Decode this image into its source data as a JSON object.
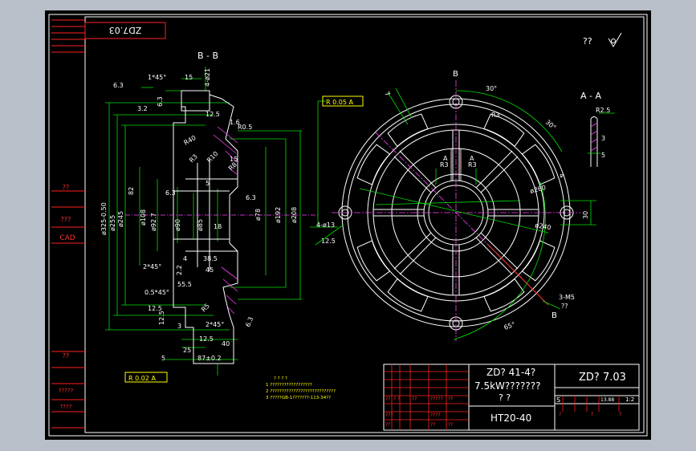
{
  "drawing": {
    "code_rotated": "ZD7.03",
    "sheet_marks": "??",
    "section_bb": "B - B",
    "section_aa": "A - A",
    "view_marker_b": "B",
    "view_marker_b_bottom": "B",
    "view_marker_a": "A",
    "left_panel": {
      "label_1": "??",
      "label_2": "???",
      "label_cad": "CAD",
      "label_3": "??",
      "label_4": "?????",
      "label_5": "????"
    },
    "dims_bb": {
      "chamfer_top": "1*45°",
      "d15": "15",
      "d4_21": "4-ø21",
      "rough_63": "6.3",
      "rough_32": "3.2",
      "rough_63b": "6.3",
      "d125": "12.5",
      "d16": "1.6",
      "r05": "R0.5",
      "r40": "R40",
      "d15b": "15",
      "r10": "R10",
      "r3": "R3",
      "r8": "R8",
      "r10b": "R10",
      "d5": "5",
      "d82": "82",
      "d325": "ø325-0.50",
      "d255": "ø255",
      "d245": "ø245",
      "d108": "ø108",
      "d927": "ø92.7",
      "d90": "ø90",
      "d85": "ø85",
      "d78": "ø78",
      "d192": "ø192",
      "d208": "ø208",
      "d63c": "6.3",
      "d18": "18",
      "d4": "4",
      "d385": "38.5",
      "d45": "45",
      "chamfer2": "2*45°",
      "d555": "55.5",
      "d22": "2.2",
      "chamfer05": "0.5*45°",
      "d125b": "12.5",
      "d125c": "12.5",
      "r5": "R5",
      "d3": "3",
      "chamfer2b": "2*45°",
      "d63d": "6.3",
      "d125d": "12.5",
      "d40": "40",
      "d25": "25",
      "d5b": "5",
      "d87": "87±0.2",
      "d4_13": "4-ø13",
      "d125e": "12.5"
    },
    "tolerance_top": "R 0.05 A",
    "tolerance_bottom": "R 0.02 A",
    "dims_circle": {
      "ang30a": "30°",
      "ang30b": "30°",
      "d7": "7",
      "r3a": "R3",
      "r3b": "R3",
      "r3c": "R3",
      "d4": "4",
      "d260": "ø260",
      "d240": "ø240",
      "d30": "30",
      "m5": "3-M5",
      "q": "??",
      "ang65": "65°"
    },
    "dims_aa": {
      "r25": "R2.5",
      "d3": "3",
      "d5": "5"
    },
    "roughness_note": "??",
    "notes": {
      "title": "? ? ? ?",
      "line1": "1 ??????????????????",
      "line2": "2 ????????????????????????????",
      "line3": "3 ?????GB-1???????-113-34??"
    },
    "title_block": {
      "product_line1": "ZD? 41-4?",
      "product_line2": "7.5kW???????",
      "product_line3": "? ?",
      "drawing_no": "ZD? 7.03",
      "material": "HT20-40",
      "s": "S",
      "scale_num": "13.88",
      "scale": "1:2",
      "q1": "??",
      "q2": "? ?",
      "q3": "??",
      "q4": "?????",
      "q5": "??",
      "q6": "???",
      "q7": "????",
      "q8": "??",
      "q9": "?",
      "q10": "?",
      "q11": "?",
      "q12": "??",
      "q13": "??"
    }
  }
}
